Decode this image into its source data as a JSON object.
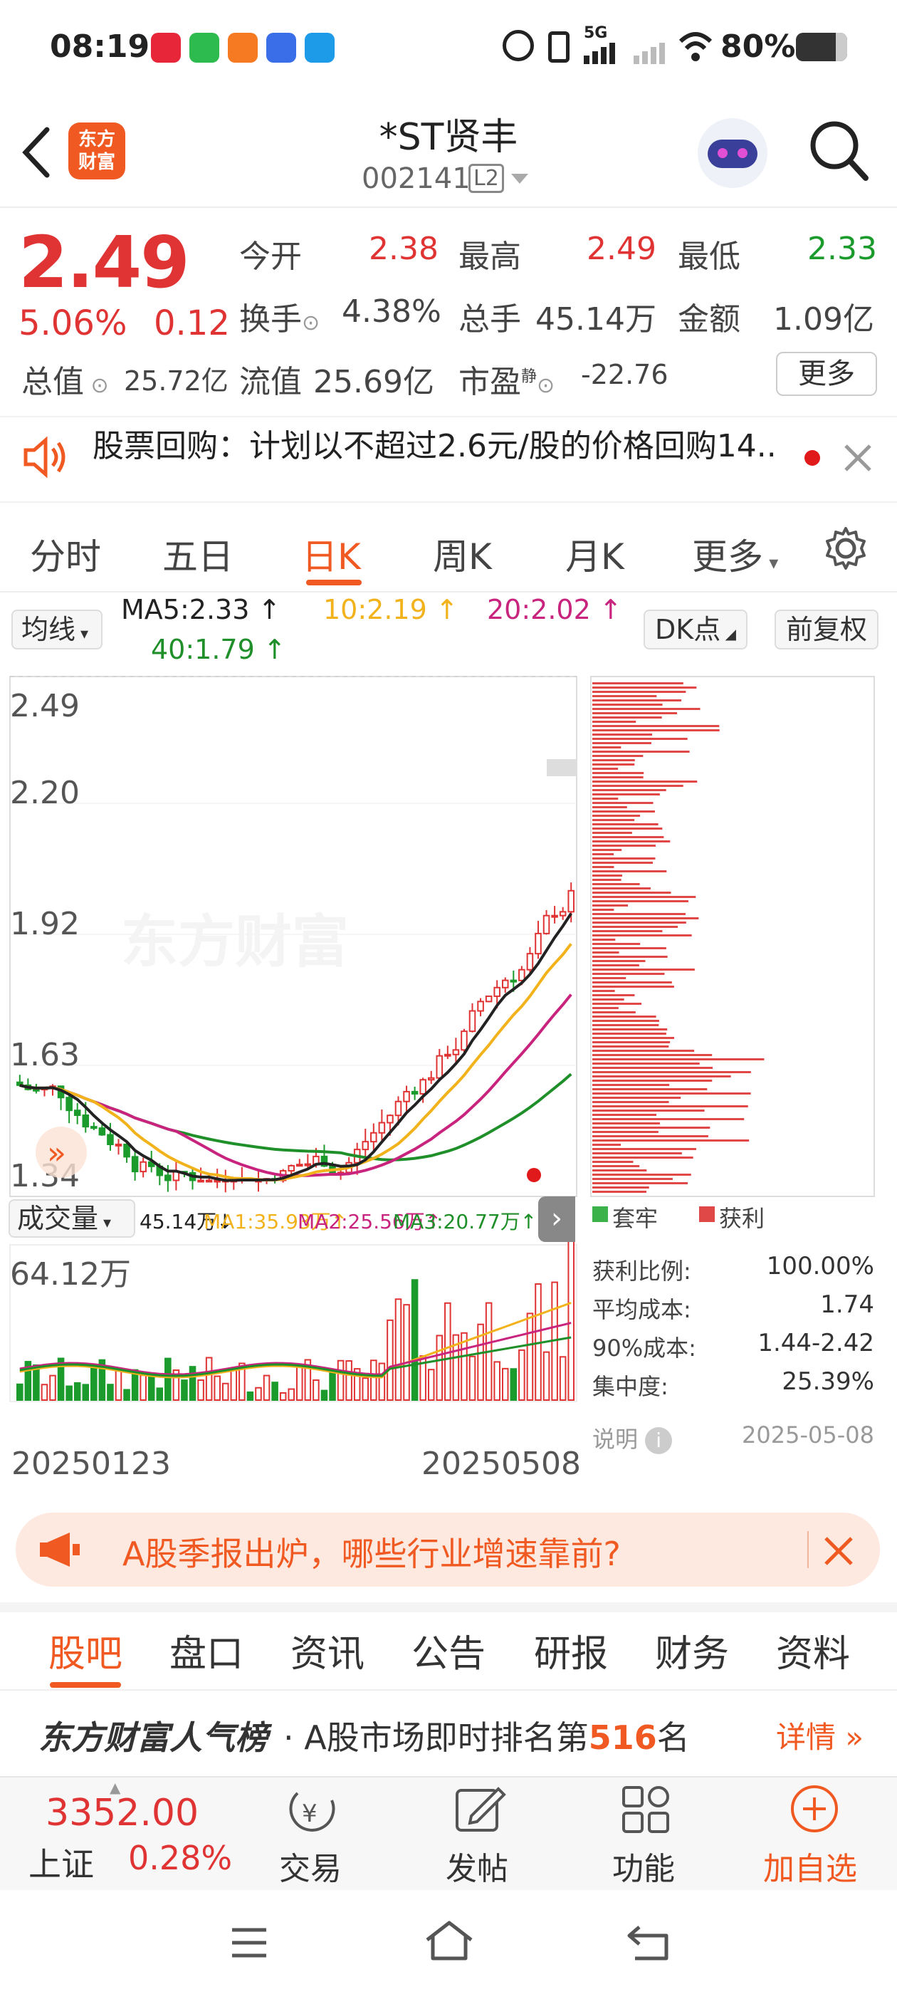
{
  "status_bar": {
    "time": "08:19",
    "battery": "80%",
    "network": "5G"
  },
  "header": {
    "title": "*ST贤丰",
    "code": "002141",
    "level": "L2",
    "logo": "东方\n财富"
  },
  "quote": {
    "price": "2.49",
    "change_pct": "5.06%",
    "change": "0.12",
    "open_label": "今开",
    "open": "2.38",
    "high_label": "最高",
    "high": "2.49",
    "low_label": "最低",
    "low": "2.33",
    "turnover_label": "换手",
    "turnover": "4.38%",
    "volume_label": "总手",
    "volume": "45.14万",
    "amount_label": "金额",
    "amount": "1.09亿",
    "mktcap_label": "总值",
    "mktcap": "25.72亿",
    "float_label": "流值",
    "float": "25.69亿",
    "pe_label": "市盈",
    "pe_sup": "静",
    "pe": "-22.76",
    "more_label": "更多"
  },
  "notice": {
    "text": "股票回购：计划以不超过2.6元/股的价格回购14.."
  },
  "tabs": [
    {
      "label": "分时"
    },
    {
      "label": "五日"
    },
    {
      "label": "日K",
      "active": true
    },
    {
      "label": "周K"
    },
    {
      "label": "月K"
    },
    {
      "label": "更多"
    }
  ],
  "ma": {
    "select_label": "均线",
    "ma5": "MA5:2.33",
    "ma10": "10:2.19",
    "ma20": "20:2.02",
    "ma40": "40:1.79",
    "dk_label": "DK点",
    "adjust_label": "前复权"
  },
  "price_axis": [
    "2.49",
    "2.20",
    "1.92",
    "1.63",
    "1.34"
  ],
  "watermark": "东方财富",
  "volume": {
    "select_label": "成交量",
    "value": "45.14万",
    "ma1": "MA1:35.93万",
    "ma2": "MA2:25.56万",
    "ma3": "MA3:20.77万",
    "max": "64.12万"
  },
  "dates": {
    "start": "20250123",
    "end": "20250508"
  },
  "chip": {
    "legend_loss": "套牢",
    "legend_profit": "获利",
    "rows": [
      {
        "label": "获利比例:",
        "value": "100.00%"
      },
      {
        "label": "平均成本:",
        "value": "1.74"
      },
      {
        "label": "90%成本:",
        "value": "1.44-2.42"
      },
      {
        "label": "集中度:",
        "value": "25.39%"
      }
    ],
    "explain_label": "说明",
    "date": "2025-05-08"
  },
  "banner": {
    "text": "A股季报出炉，哪些行业增速靠前?"
  },
  "nav_tabs": [
    {
      "label": "股吧",
      "active": true
    },
    {
      "label": "盘口"
    },
    {
      "label": "资讯"
    },
    {
      "label": "公告"
    },
    {
      "label": "研报"
    },
    {
      "label": "财务"
    },
    {
      "label": "资料"
    }
  ],
  "rank": {
    "brand": "东方财富人气榜",
    "text_a": "· A股市场即时排名第",
    "number": "516",
    "text_b": "名",
    "link": "详情"
  },
  "bottom": {
    "index_value": "3352.00",
    "index_name": "上证",
    "index_pct": "0.28%",
    "trade": "交易",
    "post": "发帖",
    "func": "功能",
    "add": "加自选"
  },
  "colors": {
    "up": "#e03333",
    "down": "#1a9b2c",
    "accent": "#f05a22",
    "ma5": "#222222",
    "ma10": "#f2b21c",
    "ma20": "#c8247e",
    "ma40": "#1f8f2a"
  }
}
